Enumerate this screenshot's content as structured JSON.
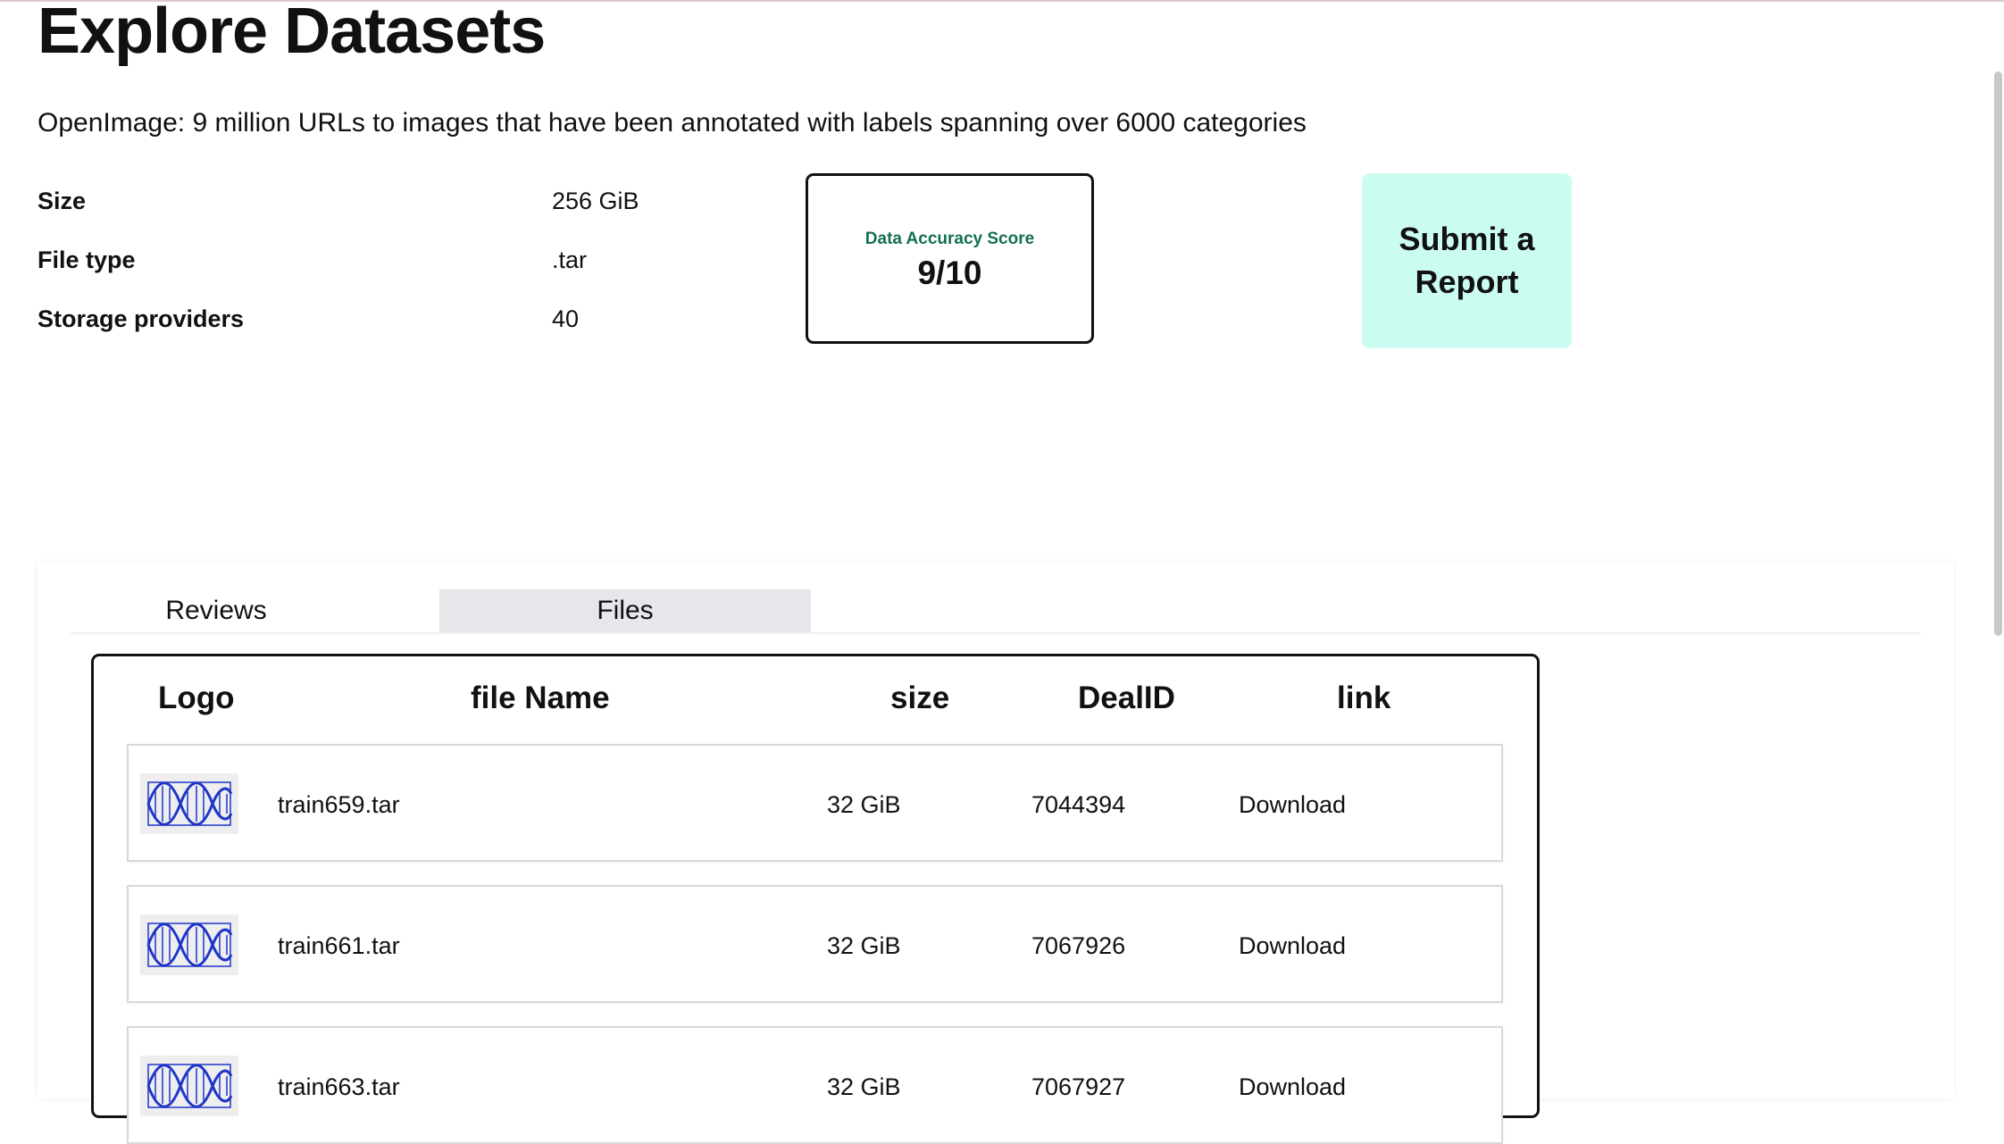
{
  "page": {
    "title": "Explore Datasets",
    "description": "OpenImage: 9 million URLs to images that have been annotated with labels spanning over 6000 categories"
  },
  "dataset_info": [
    {
      "label": "Size",
      "value": "256 GiB"
    },
    {
      "label": "File type",
      "value": ".tar"
    },
    {
      "label": "Storage providers",
      "value": "40"
    }
  ],
  "score_card": {
    "label": "Data Accuracy Score",
    "value": "9/10"
  },
  "report_button": {
    "label": "Submit a Report"
  },
  "tabs": [
    {
      "label": "Reviews",
      "active": false
    },
    {
      "label": "Files",
      "active": true
    }
  ],
  "files_table": {
    "headers": {
      "logo": "Logo",
      "file_name": "file Name",
      "size": "size",
      "deal_id": "DealID",
      "link": "link"
    },
    "rows": [
      {
        "logo_icon": "dna-icon",
        "file_name": "train659.tar",
        "size": "32 GiB",
        "deal_id": "7044394",
        "link": "Download"
      },
      {
        "logo_icon": "dna-icon",
        "file_name": "train661.tar",
        "size": "32 GiB",
        "deal_id": "7067926",
        "link": "Download"
      },
      {
        "logo_icon": "dna-icon",
        "file_name": "train663.tar",
        "size": "32 GiB",
        "deal_id": "7067927",
        "link": "Download"
      }
    ]
  },
  "colors": {
    "score_label": "#14704f",
    "report_button_bg": "#cbfcf1",
    "active_tab_bg": "#e5e7eb",
    "dna_logo": "#1f35c9"
  }
}
